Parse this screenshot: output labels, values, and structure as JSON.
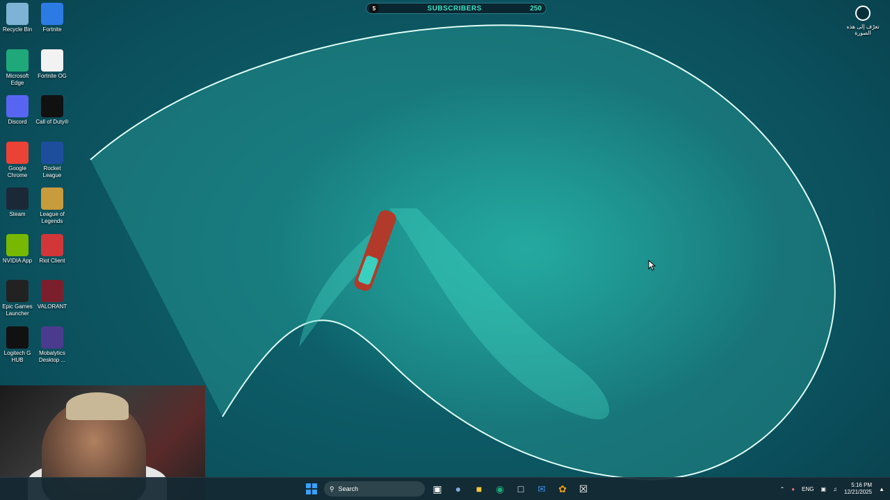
{
  "desktop_icons": [
    {
      "label": "Recycle Bin",
      "icon": "recycle-bin-icon",
      "color": "#7fb3d5"
    },
    {
      "label": "Fortnite",
      "icon": "fortnite-icon",
      "color": "#2c7be5"
    },
    {
      "label": "Microsoft Edge",
      "icon": "edge-icon",
      "color": "#1fa97a"
    },
    {
      "label": "Fortnite OG",
      "icon": "file-icon",
      "color": "#f2f2f2"
    },
    {
      "label": "Discord",
      "icon": "discord-icon",
      "color": "#5865f2"
    },
    {
      "label": "Call of Duty®",
      "icon": "call-of-duty-icon",
      "color": "#111111"
    },
    {
      "label": "Google Chrome",
      "icon": "chrome-icon",
      "color": "#ea4335"
    },
    {
      "label": "Rocket League",
      "icon": "rocket-league-icon",
      "color": "#1d4e9e"
    },
    {
      "label": "Steam",
      "icon": "steam-icon",
      "color": "#1b2838"
    },
    {
      "label": "League of Legends",
      "icon": "league-of-legends-icon",
      "color": "#c89b3c"
    },
    {
      "label": "NVIDIA App",
      "icon": "nvidia-icon",
      "color": "#76b900"
    },
    {
      "label": "Riot Client",
      "icon": "riot-client-icon",
      "color": "#d13639"
    },
    {
      "label": "Epic Games Launcher",
      "icon": "epic-games-icon",
      "color": "#222222"
    },
    {
      "label": "VALORANT",
      "icon": "valorant-icon",
      "color": "#7a1f2b"
    },
    {
      "label": "Logitech G HUB",
      "icon": "logitech-icon",
      "color": "#111111"
    },
    {
      "label": "Mobalytics Desktop ...",
      "icon": "mobalytics-icon",
      "color": "#4b3b8f"
    }
  ],
  "subscribers": {
    "current": "5",
    "title": "SUBSCRIBERS",
    "goal": "250"
  },
  "lens": {
    "label": "تعرّف إلى هذه الصورة"
  },
  "taskbar": {
    "search_label": "Search",
    "tray_lang": "ENG",
    "time": "5:16 PM",
    "date": "12/21/2025"
  }
}
